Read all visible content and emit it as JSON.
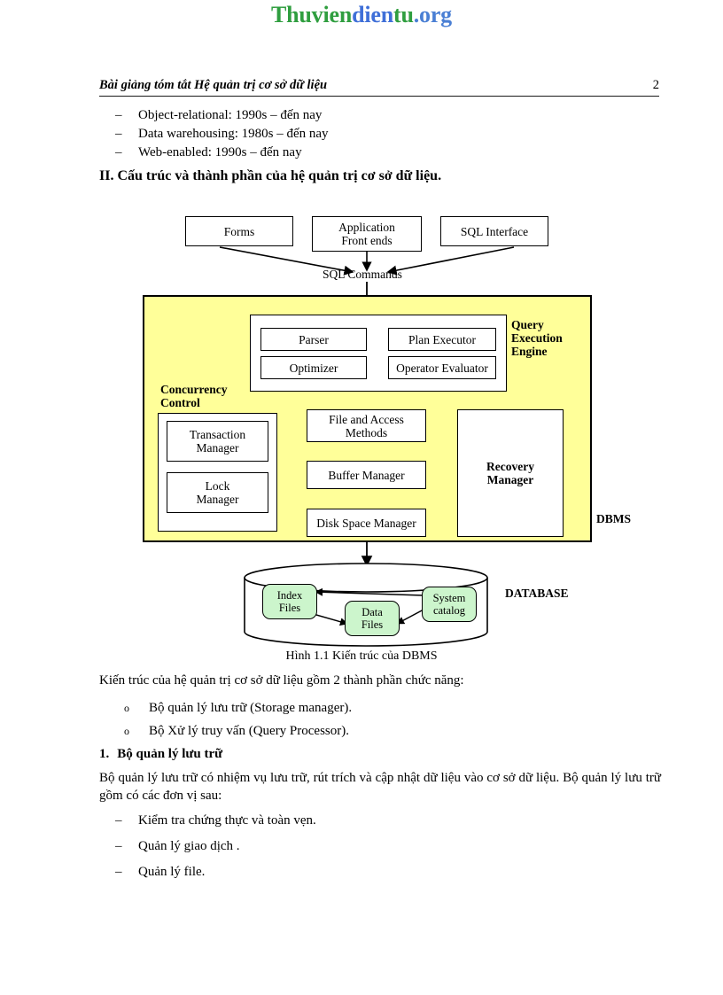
{
  "logo": {
    "part1": "Thuvien",
    "part2": "dien",
    "part3": "tu",
    "part4": ".org"
  },
  "header": {
    "title": "Bài giảng tóm tắt Hệ quản trị cơ sở dữ liệu",
    "page_number": "2"
  },
  "top_list": {
    "marker": "–",
    "items": [
      "Object-relational: 1990s – đến nay",
      "Data warehousing:  1980s – đến nay",
      "Web-enabled:  1990s – đến nay"
    ]
  },
  "section_heading": "II. Cấu trúc và thành phần của hệ quản trị cơ sở dữ liệu.",
  "diagram": {
    "top_boxes": [
      {
        "label": "Forms"
      },
      {
        "label": "Application\nFront ends"
      },
      {
        "label": "SQL Interface"
      }
    ],
    "sql_commands_label": "SQL Commands",
    "query_engine_label": "Query\nExecution\nEngine",
    "query_engine_boxes": [
      "Parser",
      "Plan Executor",
      "Optimizer",
      "Operator Evaluator"
    ],
    "concurrency_label": "Concurrency\nControl",
    "concurrency_boxes": [
      "Transaction\nManager",
      "Lock\nManager"
    ],
    "center_boxes": [
      "File and Access\nMethods",
      "Buffer Manager",
      "Disk Space Manager"
    ],
    "recovery_label": "Recovery\nManager",
    "dbms_label": "DBMS",
    "database_label": "DATABASE",
    "db_items": [
      "Index\nFiles",
      "Data\nFiles",
      "System\ncatalog"
    ],
    "colors": {
      "panel_fill": "#ffff99",
      "db_item_fill": "#ccf5cc",
      "stroke": "#000000"
    }
  },
  "figure_caption": "Hình 1.1 Kiến trúc của DBMS",
  "intro_paragraph": "Kiến trúc của hệ quản trị cơ sở dữ liệu gồm 2 thành phần chức năng:",
  "circle_list": {
    "marker": "o",
    "items": [
      "Bộ quản lý lưu trữ (Storage manager).",
      "Bộ Xử lý truy vấn (Query Processor)."
    ]
  },
  "numbered_heading": {
    "number": "1.",
    "text": "Bộ quản lý lưu trữ"
  },
  "body_paragraph": "Bộ quản lý lưu trữ có nhiệm vụ lưu trữ, rút trích và cập nhật dữ liệu vào cơ sở dữ liệu. Bộ quản lý lưu trữ gồm có các đơn vị sau:",
  "bottom_list": {
    "marker": "–",
    "items": [
      "Kiểm tra chứng thực và toàn vẹn.",
      "Quản lý giao dịch .",
      "Quản lý file."
    ]
  }
}
